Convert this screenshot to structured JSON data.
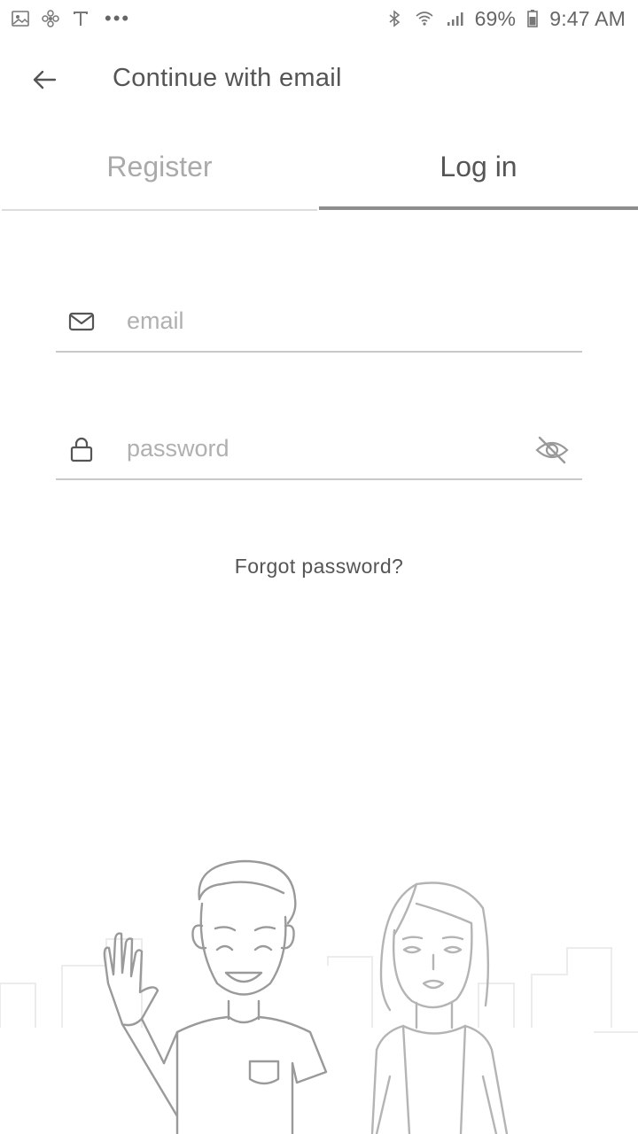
{
  "status_bar": {
    "left_icons": [
      "gallery-icon",
      "pinwheel-icon",
      "t-mobile-icon"
    ],
    "more": "•••",
    "right_icons": [
      "bluetooth-icon",
      "wifi-icon",
      "signal-icon"
    ],
    "battery": "69%",
    "time": "9:47 AM"
  },
  "app_bar": {
    "title": "Continue with email"
  },
  "tabs": {
    "register": "Register",
    "login": "Log in",
    "active": "login"
  },
  "form": {
    "email": {
      "value": "",
      "placeholder": "email",
      "icon": "mail-icon"
    },
    "password": {
      "value": "",
      "placeholder": "password",
      "icon": "lock-icon",
      "visibility_icon": "eye-off-icon"
    },
    "forgot_password": "Forgot password?"
  },
  "colors": {
    "text_primary": "#555555",
    "tab_inactive": "#aaaaaa",
    "placeholder": "#b0b0b0",
    "active_indicator": "#8e8e8e"
  }
}
